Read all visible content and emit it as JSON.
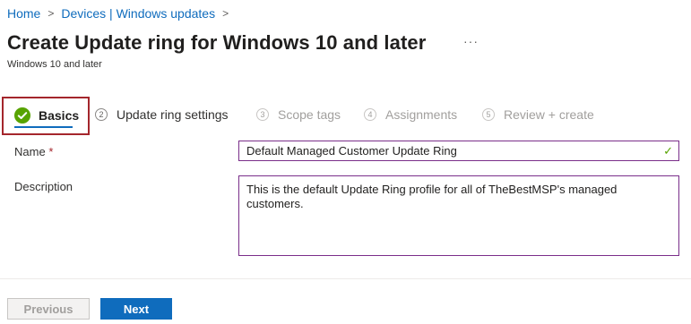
{
  "breadcrumb": {
    "home": "Home",
    "devices": "Devices | Windows updates",
    "separator": ">"
  },
  "header": {
    "title": "Create Update ring for Windows 10 and later",
    "more": "···",
    "subtitle": "Windows 10 and later"
  },
  "wizard": {
    "steps": [
      {
        "number": "1",
        "label": "Basics",
        "state": "completed-active"
      },
      {
        "number": "2",
        "label": "Update ring settings",
        "state": "enabled"
      },
      {
        "number": "3",
        "label": "Scope tags",
        "state": "disabled"
      },
      {
        "number": "4",
        "label": "Assignments",
        "state": "disabled"
      },
      {
        "number": "5",
        "label": "Review + create",
        "state": "disabled"
      }
    ]
  },
  "form": {
    "name": {
      "label": "Name",
      "required_marker": "*",
      "value": "Default Managed Customer Update Ring",
      "valid_icon": "✓"
    },
    "description": {
      "label": "Description",
      "value": "This is the default Update Ring profile for all of TheBestMSP's managed customers."
    }
  },
  "footer": {
    "previous_label": "Previous",
    "next_label": "Next"
  },
  "colors": {
    "accent": "#0f6cbd",
    "highlight_border": "#a4262c",
    "success": "#57a300",
    "input_border": "#7a2e8a"
  }
}
